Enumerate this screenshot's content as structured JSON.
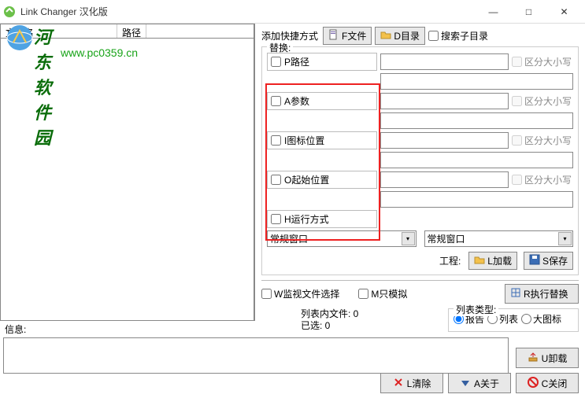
{
  "window": {
    "title": "Link Changer 汉化版",
    "min": "—",
    "max": "□",
    "close": "✕"
  },
  "watermark": {
    "title": "河东软件园",
    "url": "www.pc0359.cn"
  },
  "list": {
    "col_filename": "文件名",
    "col_path": "路径"
  },
  "add": {
    "label": "添加快捷方式",
    "file_btn": "F文件",
    "dir_btn": "D目录",
    "search_sub": "搜索子目录"
  },
  "replace": {
    "legend": "替换:",
    "path": "P路径",
    "args": "A参数",
    "icon": "I图标位置",
    "start": "O起始位置",
    "runmode": "H运行方式",
    "case": "区分大小写",
    "combo_normal": "常规窗口"
  },
  "project": {
    "label": "工程:",
    "load": "L加载",
    "save": "S保存"
  },
  "watch": {
    "watch_select": "W监视文件选择",
    "simulate": "M只模拟",
    "exec": "R执行替换"
  },
  "stats": {
    "listed": "列表内文件: 0",
    "selected": "已选: 0"
  },
  "listtype": {
    "legend": "列表类型:",
    "report": "报告",
    "list": "列表",
    "bigicon": "大图标"
  },
  "info": {
    "label": "信息:"
  },
  "bottom": {
    "unload": "U卸载",
    "clear": "L清除",
    "about": "A关于",
    "close": "C关闭"
  }
}
